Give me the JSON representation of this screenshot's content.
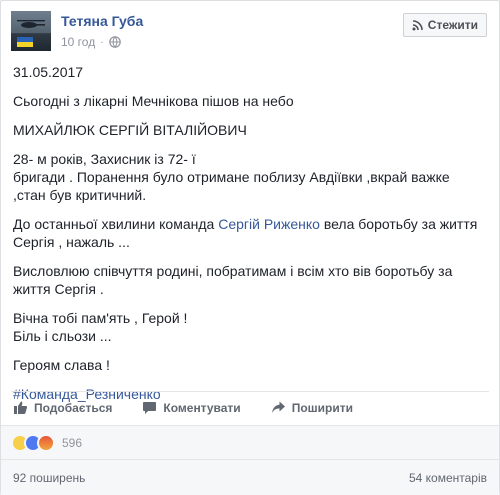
{
  "post": {
    "author": "Тетяна Губа",
    "time": "10 год",
    "dot": "·",
    "follow_label": "Стежити",
    "date": "31.05.2017",
    "lines": {
      "l1": "Сьогодні з лікарні Мечнікова пішов на небо",
      "l2": "МИХАЙЛЮК СЕРГІЙ ВІТАЛІЙОВИЧ",
      "l3a": "28- м років, Захисник із 72- ї",
      "l3b": "бригади . Поранення було отримане поблизу Авдіївки ,вкрай важке",
      "l3c": ",стан був критичний.",
      "l4_pre": "До останньої хвилини команда ",
      "l4_link": "Сергій Риженко",
      "l4_post": " вела боротьбу за життя",
      "l4b": "Сергія , нажаль ...",
      "l5a": "Висловлюю співчуття родині, побратимам і всім хто вів боротьбу за",
      "l5b": "життя Сергія .",
      "l6a": "Вічна тобі пам'ять , Герой !",
      "l6b": "Біль і сльози ...",
      "l7": "Героям слава !",
      "hashtag": "#Команда_Резниченко"
    }
  },
  "actions": {
    "share": "Подобається",
    "comment": "Коментувати",
    "forward": "Поширити"
  },
  "reactions": {
    "count": "596"
  },
  "footer": {
    "shares": "92 поширень",
    "comments": "54 коментарів"
  },
  "icons": {
    "avatar": "profile-photo",
    "globe": "globe-icon",
    "rss": "rss-icon",
    "like": "thumbs-up-icon",
    "comment": "comment-icon",
    "share": "share-arrow-icon"
  },
  "colors": {
    "link": "#365899",
    "text": "#1d2129",
    "muted": "#90949c"
  }
}
